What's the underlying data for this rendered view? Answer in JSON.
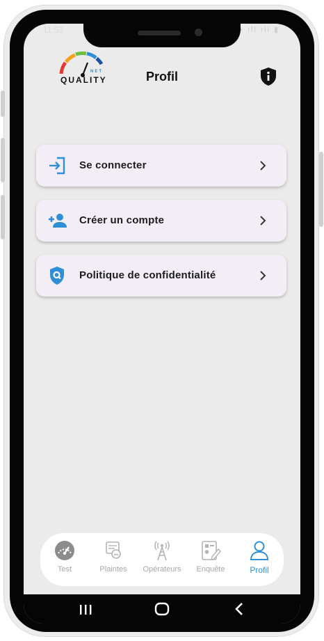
{
  "status_bar": {
    "time": "11:53",
    "icons": "▪ ıll ıll ▮"
  },
  "header": {
    "logo_text": "QUALITY",
    "logo_subtext": "NET",
    "title": "Profil"
  },
  "menu": [
    {
      "label": "Se connecter",
      "icon": "login-icon"
    },
    {
      "label": "Créer un compte",
      "icon": "person-add-icon"
    },
    {
      "label": "Politique de confidentialité",
      "icon": "shield-search-icon"
    }
  ],
  "bottom_nav": [
    {
      "label": "Test",
      "icon": "speedometer-icon",
      "active": false
    },
    {
      "label": "Plaintes",
      "icon": "complaint-icon",
      "active": false
    },
    {
      "label": "Opérateurs",
      "icon": "antenna-icon",
      "active": false
    },
    {
      "label": "Enquête",
      "icon": "survey-icon",
      "active": false
    },
    {
      "label": "Profil",
      "icon": "person-icon",
      "active": true
    }
  ],
  "colors": {
    "accent": "#2f8fd6",
    "card_bg": "#f3eef5",
    "screen_bg": "#ebebeb",
    "inactive": "#a6a6a6"
  }
}
